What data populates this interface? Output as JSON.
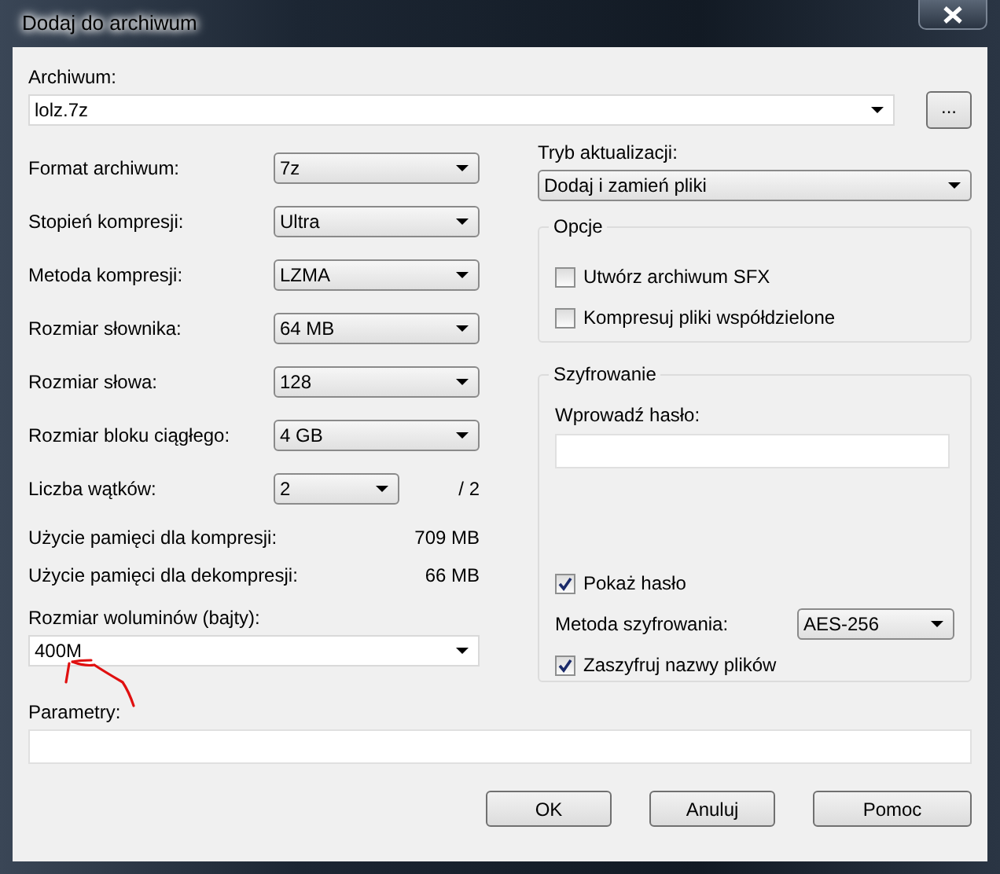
{
  "window": {
    "title": "Dodaj do archiwum"
  },
  "archive": {
    "label": "Archiwum:",
    "value": "lolz.7z",
    "browse": "..."
  },
  "settings": [
    {
      "label": "Format archiwum:",
      "value": "7z"
    },
    {
      "label": "Stopień kompresji:",
      "value": "Ultra"
    },
    {
      "label": "Metoda kompresji:",
      "value": "LZMA"
    },
    {
      "label": "Rozmiar słownika:",
      "value": "64 MB"
    },
    {
      "label": "Rozmiar słowa:",
      "value": "128"
    },
    {
      "label": "Rozmiar bloku ciągłego:",
      "value": "4 GB"
    },
    {
      "label": "Liczba wątków:",
      "value": "2",
      "suffix": "/ 2"
    }
  ],
  "memory": [
    {
      "label": "Użycie pamięci dla kompresji:",
      "value": "709 MB"
    },
    {
      "label": "Użycie pamięci dla dekompresji:",
      "value": "66 MB"
    }
  ],
  "volume": {
    "label": "Rozmiar woluminów (bajty):",
    "value": "400M"
  },
  "parameters": {
    "label": "Parametry:"
  },
  "update_mode": {
    "label": "Tryb aktualizacji:",
    "value": "Dodaj i zamień pliki"
  },
  "options": {
    "title": "Opcje",
    "items": [
      {
        "label": "Utwórz archiwum SFX",
        "checked": false
      },
      {
        "label": "Kompresuj pliki współdzielone",
        "checked": false
      }
    ]
  },
  "encryption": {
    "title": "Szyfrowanie",
    "password_label": "Wprowadź hasło:",
    "show_password": {
      "label": "Pokaż hasło",
      "checked": true
    },
    "method": {
      "label": "Metoda szyfrowania:",
      "value": "AES-256"
    },
    "encrypt_names": {
      "label": "Zaszyfruj nazwy plików",
      "checked": true
    }
  },
  "buttons": [
    "OK",
    "Anuluj",
    "Pomoc"
  ]
}
